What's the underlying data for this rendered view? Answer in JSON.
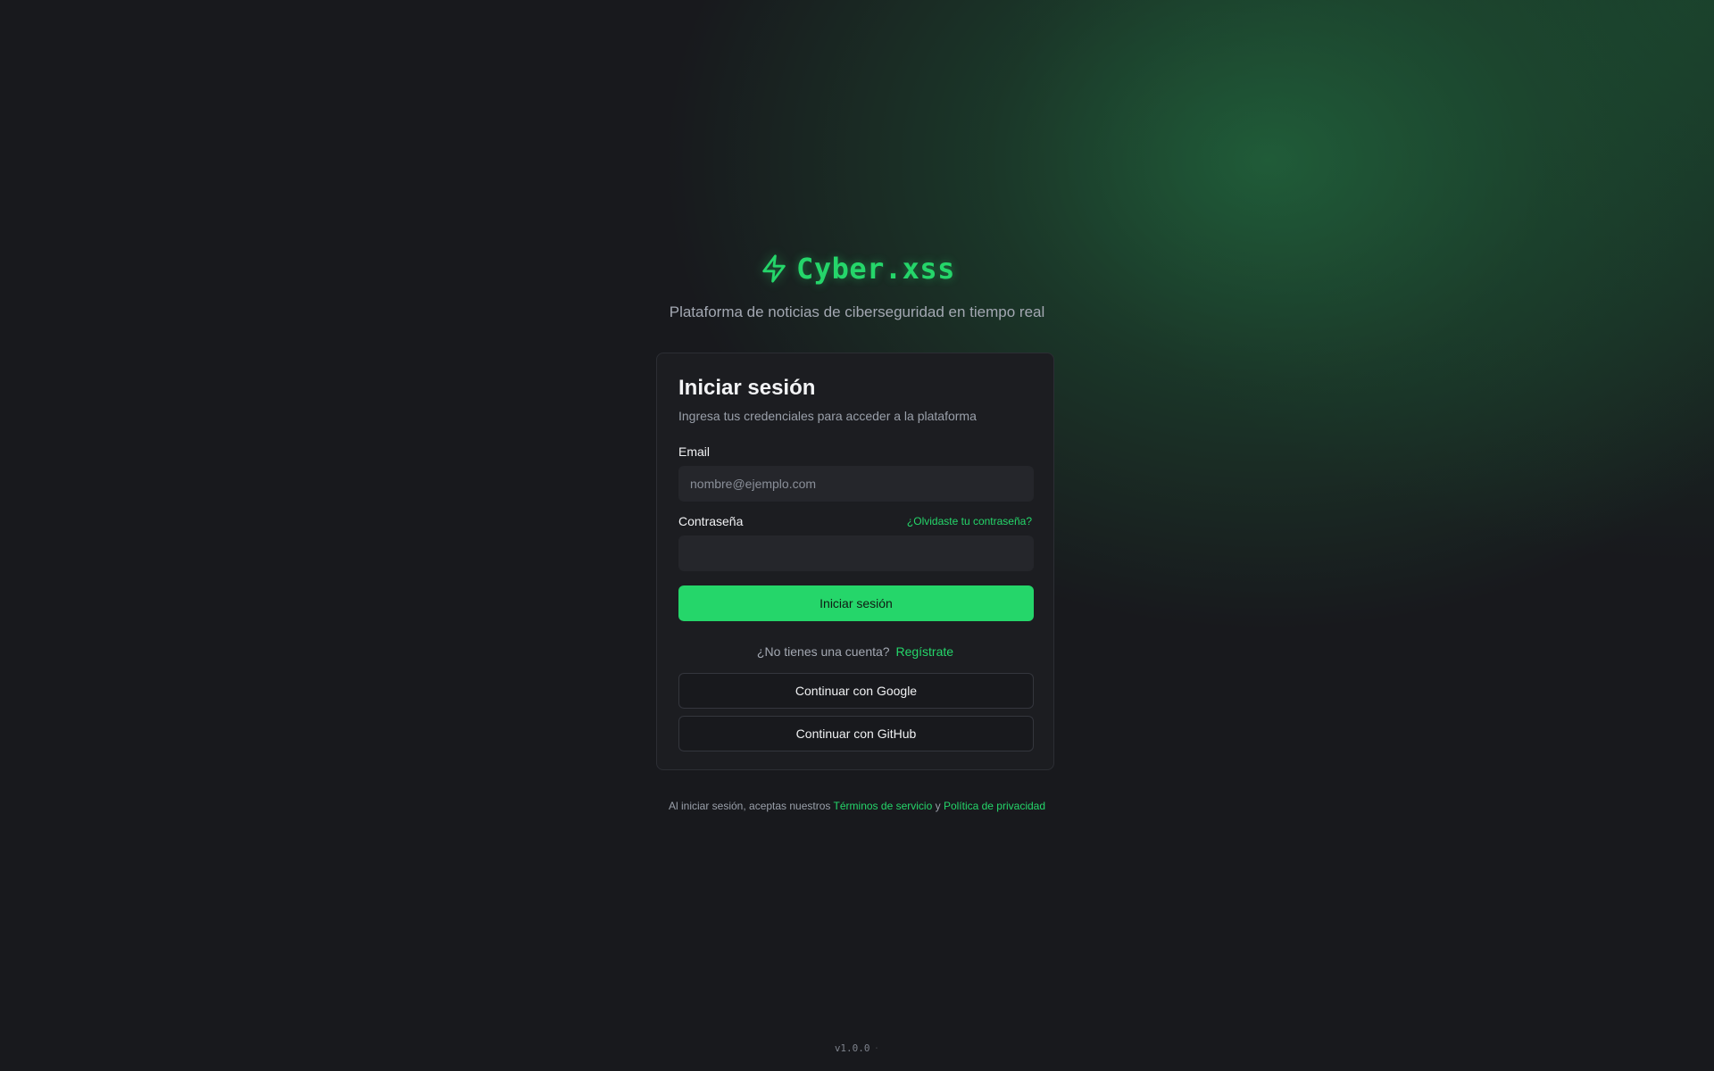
{
  "brand": {
    "icon": "lightning-bolt-icon",
    "name": "Cyber.xss",
    "tagline": "Plataforma de noticias de ciberseguridad en tiempo real"
  },
  "login_card": {
    "title": "Iniciar sesión",
    "subtitle": "Ingresa tus credenciales para acceder a la plataforma",
    "email": {
      "label": "Email",
      "placeholder": "nombre@ejemplo.com",
      "value": ""
    },
    "password": {
      "label": "Contraseña",
      "forgot_label": "¿Olvidaste tu contraseña?",
      "value": ""
    },
    "submit_label": "Iniciar sesión",
    "signup_prompt": "¿No tienes una cuenta?",
    "signup_link": "Regístrate",
    "google_label": "Continuar con Google",
    "github_label": "Continuar con GitHub"
  },
  "footer": {
    "terms_prefix": "Al iniciar sesión, aceptas nuestros",
    "terms_link": "Términos de servicio",
    "conjunction": "y",
    "privacy_link": "Política de privacidad",
    "version": "v1.0.0",
    "version_separator": "·"
  },
  "colors": {
    "accent": "#25d66a",
    "background": "#18191d",
    "card": "#1c1d21",
    "input": "#25262b"
  }
}
